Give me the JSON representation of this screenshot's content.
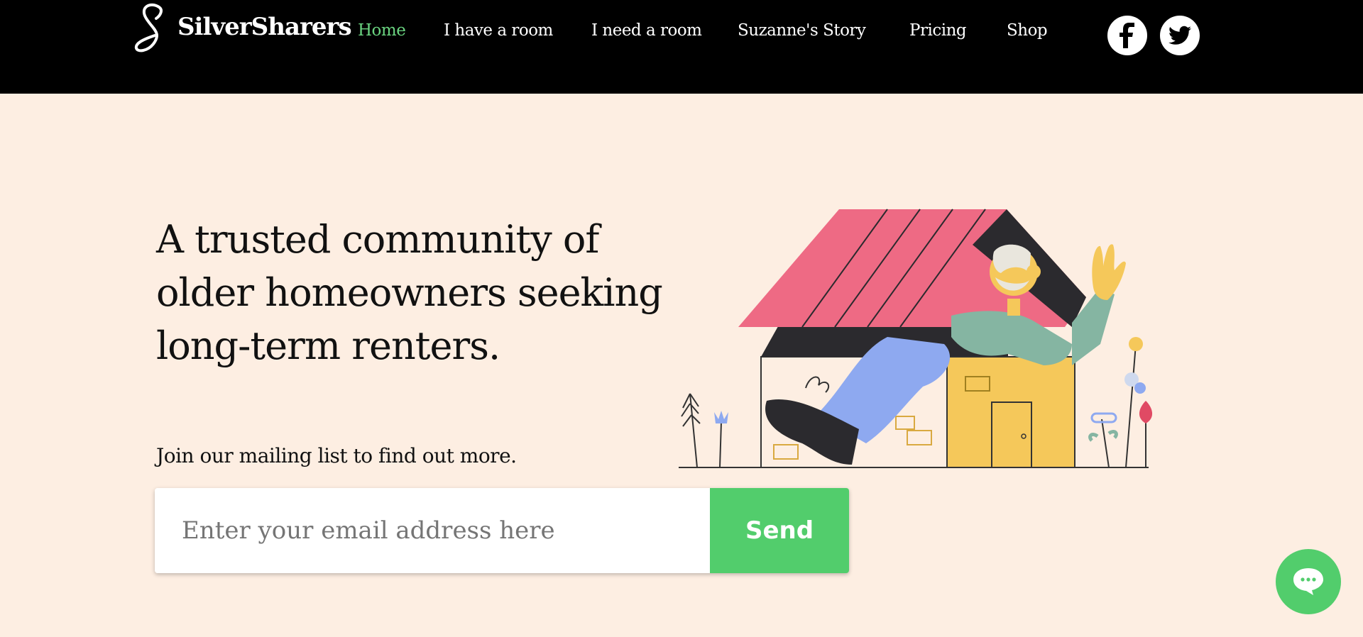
{
  "header": {
    "brand": "SilverSharers",
    "nav": [
      {
        "label": "Home",
        "active": true
      },
      {
        "label": "I have a room",
        "active": false
      },
      {
        "label": "I need a room",
        "active": false
      },
      {
        "label": "Suzanne's Story",
        "active": false
      },
      {
        "label": "Pricing",
        "active": false
      },
      {
        "label": "Shop",
        "active": false
      }
    ],
    "social": [
      {
        "icon": "facebook-icon"
      },
      {
        "icon": "twitter-icon"
      }
    ]
  },
  "hero": {
    "headline": "A trusted community of older homeowners seeking long-term renters.",
    "subtext": "Join our mailing list to find out more.",
    "email_placeholder": "Enter your email address here",
    "send_label": "Send",
    "illustration": "house-illustration"
  },
  "chat": {
    "icon": "chat-icon"
  },
  "colors": {
    "header_bg": "#000000",
    "page_bg": "#fdeee2",
    "accent_green": "#52cd6c",
    "active_nav": "#6ad480"
  }
}
